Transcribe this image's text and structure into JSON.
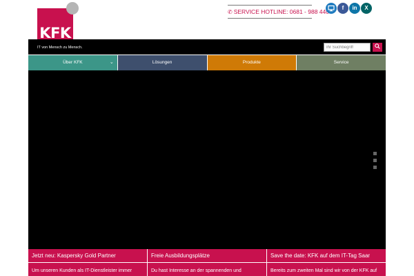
{
  "header": {
    "logo_text": "KFK",
    "tagline": "IT von Mensch zu Mensch.",
    "hotline_label": "SERVICE HOTLINE: 0681 - 988 440"
  },
  "social": {
    "icons": [
      "desktop-icon",
      "facebook-icon",
      "linkedin-icon",
      "xing-icon"
    ],
    "facebook_glyph": "f",
    "linkedin_glyph": "in",
    "xing_glyph": "X"
  },
  "search": {
    "placeholder": "Ihr Suchbegriff"
  },
  "nav": {
    "items": [
      {
        "label": "Über KFK"
      },
      {
        "label": "Lösungen"
      },
      {
        "label": "Produkte"
      },
      {
        "label": "Service"
      }
    ]
  },
  "news": [
    {
      "title": "Jetzt neu: Kaspersky Gold Partner",
      "text": "Um unseren Kunden als IT-Dienstleister immer"
    },
    {
      "title": "Freie Ausbildungsplätze",
      "text": "Du hast Interesse an der spannenden und"
    },
    {
      "title": "Save the date: KFK auf dem IT-Tag Saar",
      "text": "Bereits zum zweiten Mal sind wir von der KFK auf"
    }
  ],
  "colors": {
    "brand": "#c8114e",
    "nav_1": "#3c9688",
    "nav_2": "#3e4f6d",
    "nav_3": "#cf7a06",
    "nav_4": "#6f7f63"
  }
}
